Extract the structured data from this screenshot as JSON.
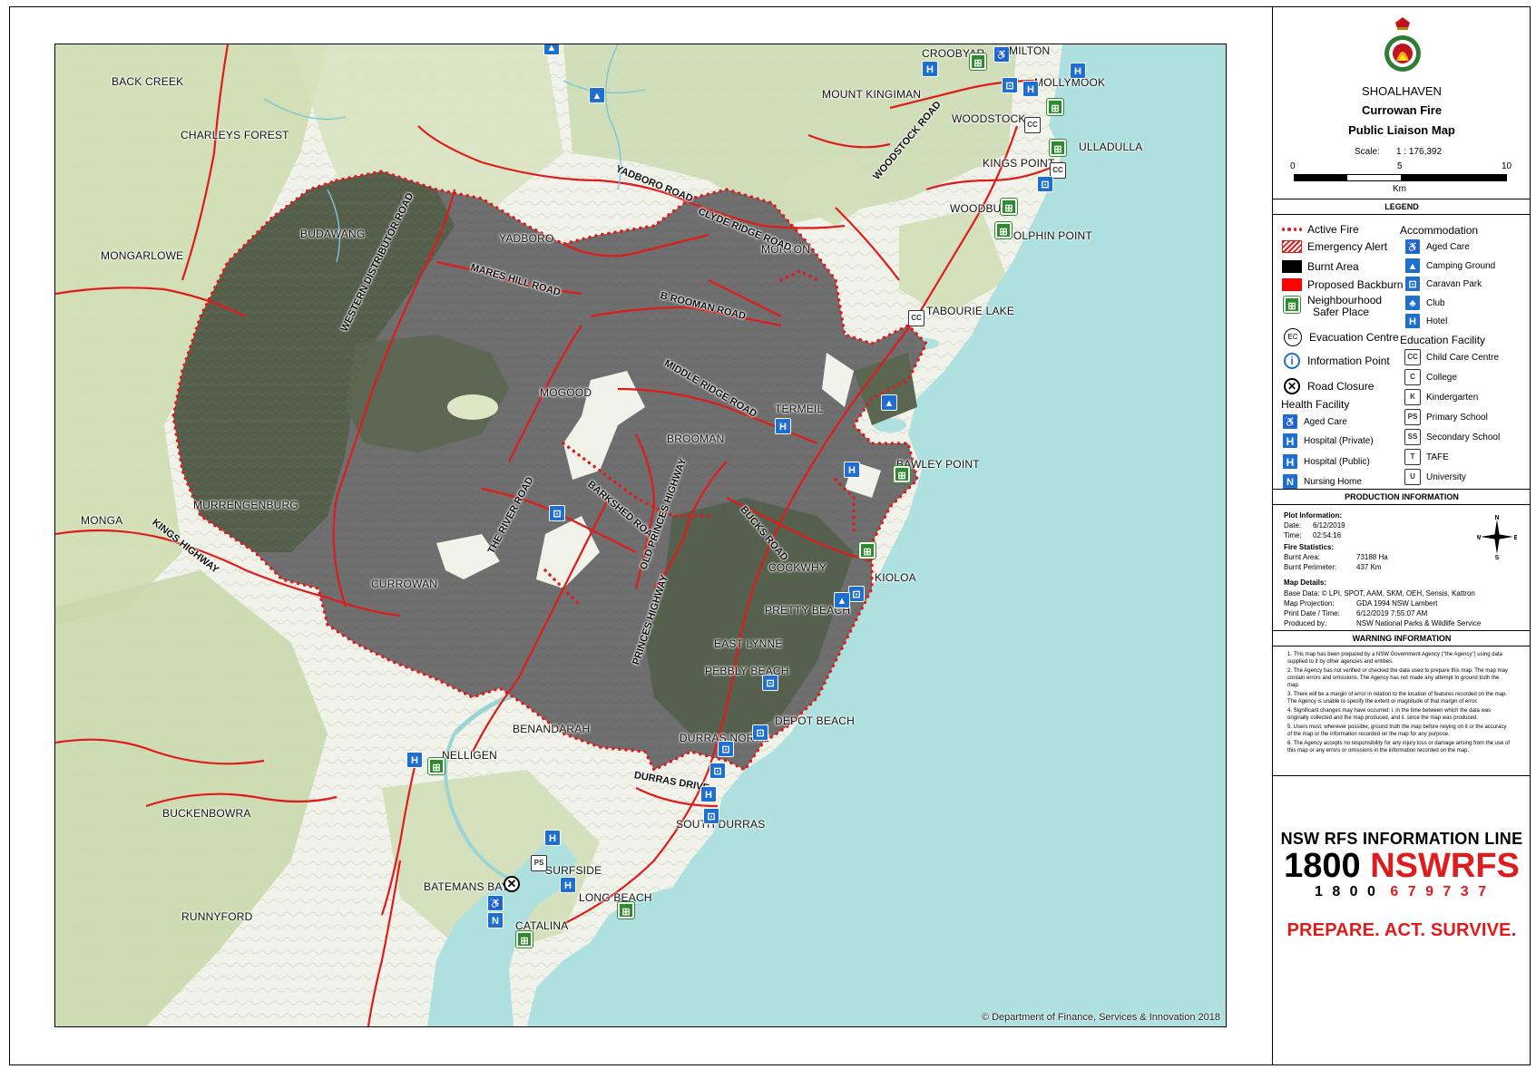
{
  "panel": {
    "council": "SHOALHAVEN",
    "title_line1": "Currowan Fire",
    "title_line2": "Public Liaison Map",
    "scale_label": "Scale:",
    "scale_value": "1 : 176,392",
    "scalebar": {
      "ticks": [
        "0",
        "5",
        "10"
      ],
      "unit": "Km"
    },
    "legend_heading": "LEGEND",
    "legend_left": [
      {
        "icon": "active-fire",
        "label": "Active Fire"
      },
      {
        "icon": "emergency-alert",
        "label": "Emergency Alert"
      },
      {
        "icon": "burnt-area",
        "label": "Burnt Area"
      },
      {
        "icon": "proposed-backburn",
        "label": "Proposed Backburn"
      },
      {
        "icon": "neighbourhood-safer-place",
        "label": "Neighbourhood",
        "label2": "Safer Place"
      },
      {
        "icon": "evacuation-centre",
        "label": "Evacuation Centre"
      },
      {
        "icon": "information-point",
        "label": "Information Point"
      },
      {
        "icon": "road-closure",
        "label": "Road Closure"
      }
    ],
    "health_heading": "Health Facility",
    "health": [
      {
        "icon": "aged-care",
        "label": "Aged Care"
      },
      {
        "icon": "hospital-private",
        "label": "Hospital (Private)"
      },
      {
        "icon": "hospital-public",
        "label": "Hospital (Public)"
      },
      {
        "icon": "nursing-home",
        "label": "Nursing Home"
      }
    ],
    "accommodation_heading": "Accommodation",
    "accommodation": [
      {
        "icon": "aged-care",
        "label": "Aged Care"
      },
      {
        "icon": "camping-ground",
        "label": "Camping Ground"
      },
      {
        "icon": "caravan-park",
        "label": "Caravan Park"
      },
      {
        "icon": "club",
        "label": "Club"
      },
      {
        "icon": "hotel",
        "label": "Hotel"
      }
    ],
    "education_heading": "Education Facility",
    "education": [
      {
        "icon": "child-care-centre",
        "label": "Child Care Centre"
      },
      {
        "icon": "college",
        "label": "College"
      },
      {
        "icon": "kindergarten",
        "label": "Kindergarten"
      },
      {
        "icon": "primary-school",
        "label": "Primary School"
      },
      {
        "icon": "secondary-school",
        "label": "Secondary School"
      },
      {
        "icon": "tafe",
        "label": "TAFE"
      },
      {
        "icon": "university",
        "label": "University"
      }
    ],
    "production_heading": "PRODUCTION INFORMATION",
    "plot_info_heading": "Plot Information:",
    "date_label": "Date:",
    "date_value": "6/12/2019",
    "time_label": "Time:",
    "time_value": "02:54:16",
    "fire_stats_heading": "Fire Statistics:",
    "burnt_area_label": "Burnt Area:",
    "burnt_area_value": "73188 Ha",
    "burnt_perimeter_label": "Burnt Perimeter:",
    "burnt_perimeter_value": "437 Km",
    "map_details_heading": "Map Details:",
    "base_data": "Base Data: © LPI, SPOT, AAM, SKM, OEH, Sensis, Kattron",
    "projection_label": "Map Projection:",
    "projection_value": "GDA 1994 NSW Lambert",
    "print_label": "Print Date / Time:",
    "print_value": "6/12/2019 7:55:07 AM",
    "produced_label": "Produced by:",
    "produced_value": "NSW National Parks & Wildlife Service",
    "compass": {
      "n": "N",
      "s": "S",
      "e": "E",
      "w": "W"
    },
    "warning_heading": "WARNING INFORMATION",
    "warnings": [
      "1. This map has been prepared by a NSW Government Agency (\"the Agency\") using data supplied to it by other agencies and entities.",
      "2. The Agency has not verified or checked the data used to prepare this map. The map may contain errors and omissions. The Agency has not made any attempt to ground truth the map.",
      "3. There will be a margin of error in relation to the location of features recorded on the map. The Agency is unable to specify the extent or magnitude of that margin of error.",
      "4. Significant changes may have occurred: i. in the time between which the data was originally collected and the map produced, and ii. since the map was produced.",
      "5. Users must, wherever possible, ground truth the map before relying on it or the accuracy of the map or the information recorded on the map for any purpose.",
      "6. The Agency accepts no responsibility for any injury loss or damage arising from the use of this map or any errors or omissions in the information recorded on the map."
    ],
    "infoline_heading": "NSW RFS INFORMATION LINE",
    "infoline_1800": "1800",
    "infoline_word": "NSWRFS",
    "infoline_digits_black": "1 8 0 0",
    "infoline_digits_red": "6 7 9 7 3 7",
    "slogan": "PREPARE. ACT. SURVIVE."
  },
  "map": {
    "copyright": "© Department of Finance, Services & Innovation 2018",
    "places": [
      "BACK CREEK",
      "CHARLEYS FOREST",
      "MONGARLOWE",
      "BUDAWANG",
      "YADBORO",
      "MONGA",
      "MURRENGENBURG",
      "CURROWAN",
      "MOGOOD",
      "BROOMAN",
      "TERMEIL",
      "MORTON",
      "MOUNT KINGIMAN",
      "CROOBYAR",
      "MILTON",
      "MOLLYMOOK",
      "WOODSTOCK",
      "ULLADULLA",
      "KINGS POINT",
      "WOODBURN",
      "DOLPHIN POINT",
      "TABOURIE LAKE",
      "BAWLEY POINT",
      "COCKWHY",
      "KIOLOA",
      "PRETTY BEACH",
      "EAST LYNNE",
      "PEBBLY BEACH",
      "DEPOT BEACH",
      "DURRAS NORTH",
      "SOUTH DURRAS",
      "BENANDARAH",
      "NELLIGEN",
      "BUCKENBOWRA",
      "BATEMANS BAY",
      "SURFSIDE",
      "LONG BEACH",
      "RUNNYFORD",
      "CATALINA"
    ],
    "roads": [
      "WESTERN DISTRIBUTOR ROAD",
      "MARES HILL ROAD",
      "YADBORO ROAD",
      "CLYDE RIDGE ROAD",
      "WOODSTOCK ROAD",
      "B ROOMAN ROAD",
      "MIDDLE RIDGE ROAD",
      "KINGS HIGHWAY",
      "THE RIVER ROAD",
      "BARKSHED ROAD",
      "OLD PRINCES HIGHWAY",
      "BUCKS ROAD",
      "PRINCES HIGHWAY",
      "DURRAS DRIVE"
    ]
  }
}
